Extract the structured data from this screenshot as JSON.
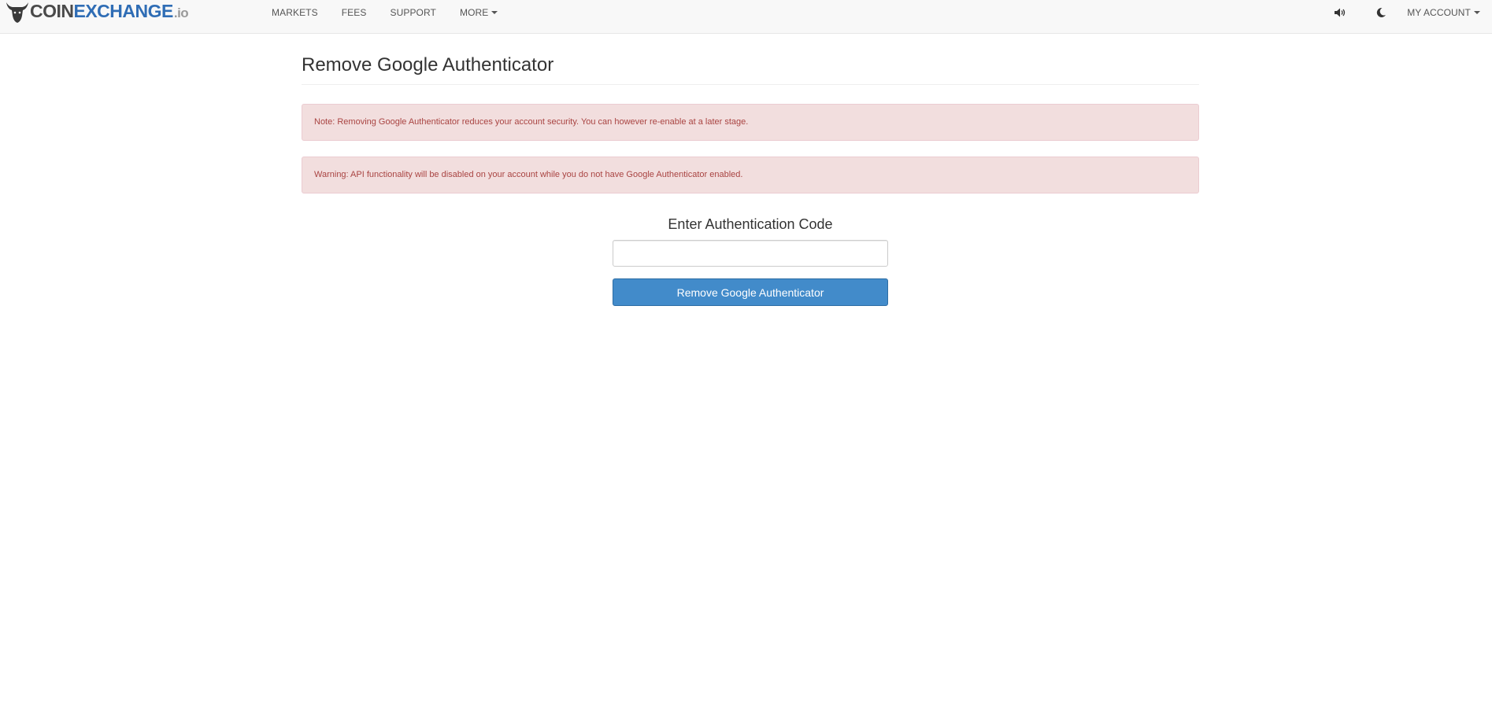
{
  "brand": {
    "part_coin": "COIN",
    "part_exchange": "EXCHANGE",
    "part_io": ".io",
    "logo_icon": "bull-head-icon",
    "color_coin": "#4a4a4a",
    "color_exchange": "#2f6db5",
    "color_io": "#9a9a9a"
  },
  "nav": {
    "items": [
      {
        "label": "MARKETS"
      },
      {
        "label": "FEES"
      },
      {
        "label": "SUPPORT"
      },
      {
        "label": "MORE",
        "dropdown": true
      }
    ],
    "right": {
      "sound_icon": "volume-icon",
      "theme_icon": "moon-icon",
      "account_label": "MY ACCOUNT"
    }
  },
  "page": {
    "title": "Remove Google Authenticator",
    "alerts": [
      {
        "text": "Note: Removing Google Authenticator reduces your account security. You can however re-enable at a later stage."
      },
      {
        "text": "Warning: API functionality will be disabled on your account while you do not have Google Authenticator enabled."
      }
    ],
    "form": {
      "label": "Enter Authentication Code",
      "input_value": "",
      "button_label": "Remove Google Authenticator"
    }
  },
  "colors": {
    "navbar_bg": "#f8f8f8",
    "alert_bg": "#f2dede",
    "alert_text": "#a94442",
    "primary_button": "#428bca"
  }
}
